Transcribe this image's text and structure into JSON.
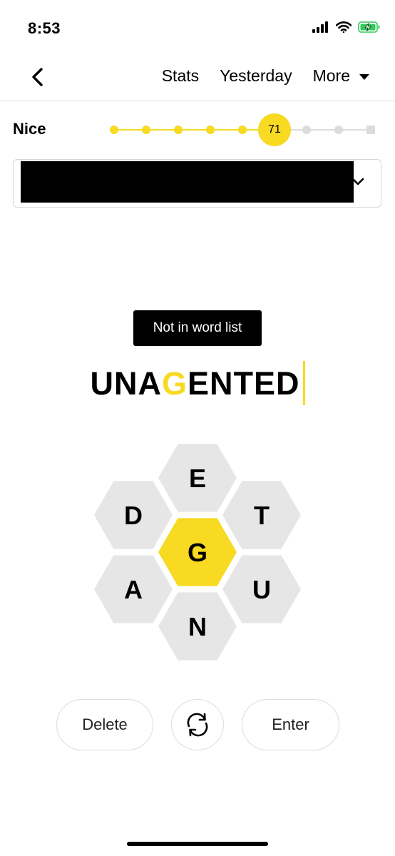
{
  "status_bar": {
    "time": "8:53",
    "icons": [
      "signal-icon",
      "wifi-icon",
      "battery-charging-icon"
    ]
  },
  "nav": {
    "back_icon": "chevron-left-icon",
    "stats_label": "Stats",
    "yesterday_label": "Yesterday",
    "more_label": "More",
    "more_icon": "caret-down-icon"
  },
  "progress": {
    "rank": "Nice",
    "score": "71",
    "steps_total": 9,
    "current_step_index": 5
  },
  "found_words": {
    "content": "",
    "expand_icon": "chevron-down-icon"
  },
  "message": {
    "text": "Not in word list"
  },
  "input": {
    "before": "UNA",
    "center": "G",
    "after": "ENTED"
  },
  "hive": {
    "center_letter": "G",
    "outer_letters": [
      "E",
      "T",
      "U",
      "N",
      "A",
      "D"
    ]
  },
  "controls": {
    "delete_label": "Delete",
    "shuffle_icon": "shuffle-icon",
    "enter_label": "Enter"
  },
  "colors": {
    "accent": "#f7da21",
    "cell": "#e6e6e6"
  }
}
